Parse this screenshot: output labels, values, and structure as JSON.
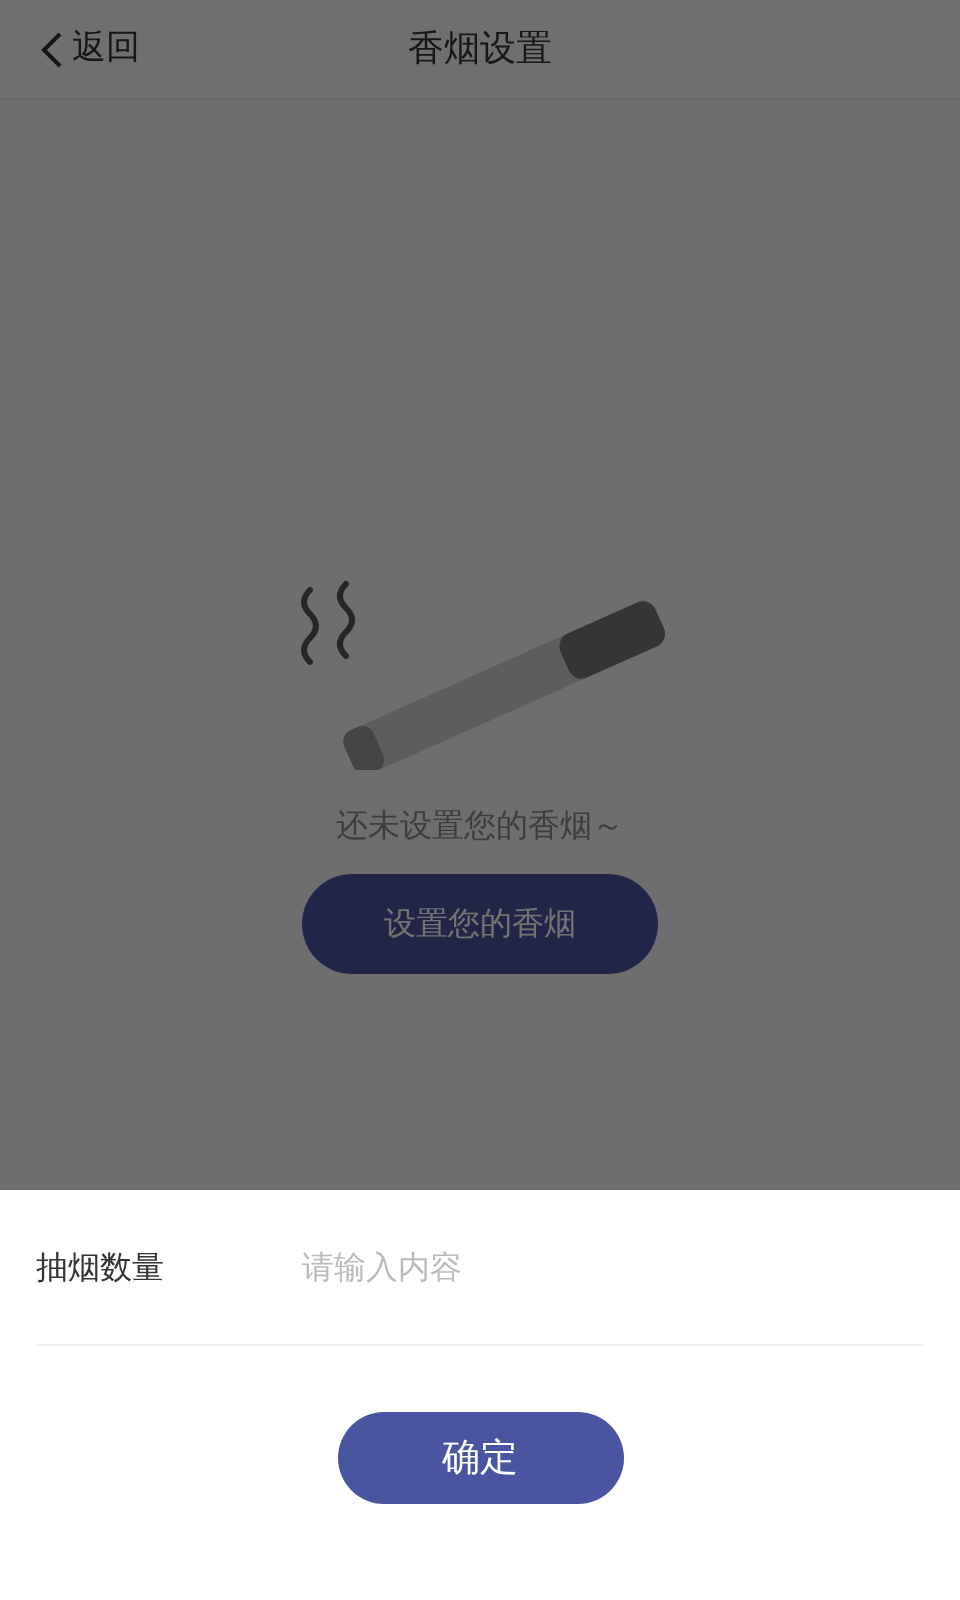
{
  "header": {
    "back": "返回",
    "title": "香烟设置"
  },
  "empty_state": {
    "message": "还未设置您的香烟～",
    "button": "设置您的香烟"
  },
  "sheet": {
    "field": {
      "label": "抽烟数量",
      "placeholder": "请输入内容"
    },
    "confirm": "确定"
  }
}
